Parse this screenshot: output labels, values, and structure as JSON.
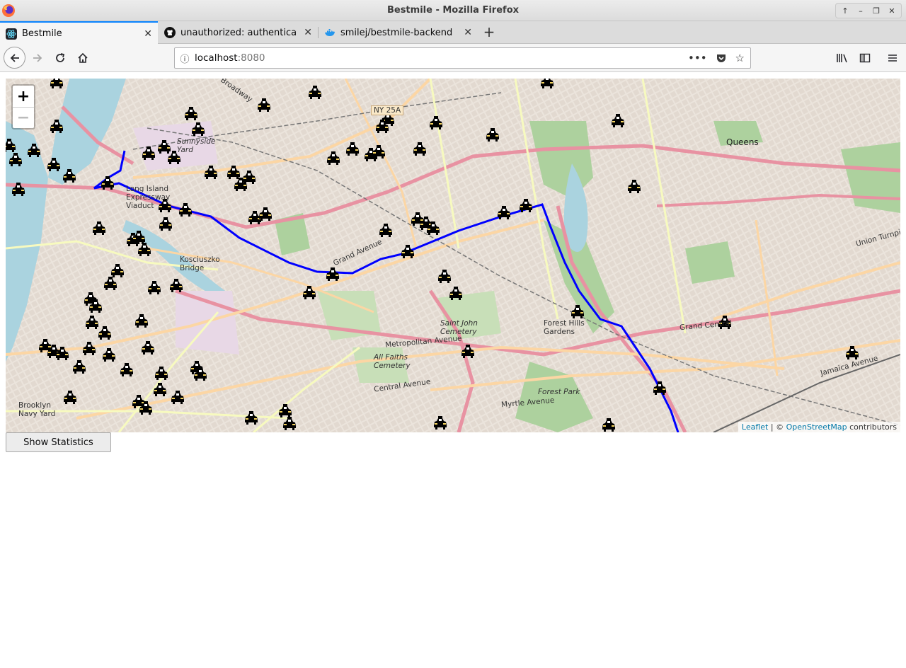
{
  "window": {
    "title": "Bestmile - Mozilla Firefox"
  },
  "tabs": [
    {
      "label": "Bestmile",
      "active": true,
      "icon": "react-icon"
    },
    {
      "label": "unauthorized: authentica",
      "active": false,
      "icon": "github-icon"
    },
    {
      "label": "smilej/bestmile-backend",
      "active": false,
      "icon": "docker-icon"
    }
  ],
  "navbar": {
    "url_host": "localhost",
    "url_port": ":8080"
  },
  "map": {
    "zoom_in": "+",
    "zoom_out": "−",
    "attribution_leaflet": "Leaflet",
    "attribution_sep": " | © ",
    "attribution_osm": "OpenStreetMap",
    "attribution_suffix": " contributors",
    "labels": {
      "queens": "Queens",
      "sunnyside_yard": "Sunnyside Yard",
      "long_island_expressway": "Long Island Expressway Viaduct",
      "kosciuszko_bridge": "Kosciuszko Bridge",
      "saint_john_cemetery": "Saint John Cemetery",
      "all_faiths_cemetery": "All Faiths Cemetery",
      "forest_hills_gardens": "Forest Hills Gardens",
      "forest_park": "Forest Park",
      "brooklyn_navy_yard": "Brooklyn Navy Yard",
      "grand_avenue": "Grand Avenue",
      "metropolitan_avenue": "Metropolitan Avenue",
      "myrtle_avenue": "Myrtle Avenue",
      "union_turnpike": "Union Turnpike",
      "jamaica_avenue": "Jamaica Avenue",
      "grand_central": "Grand Central",
      "broadway": "Broadway",
      "central_avenue": "Central Avenue",
      "ny25a": "NY 25A"
    }
  },
  "page": {
    "stats_button": "Show Statistics"
  },
  "colors": {
    "route": "#0000ff",
    "tab_accent": "#0a84ff",
    "water": "#aad3df",
    "park": "#add19e",
    "motorway": "#e892a2",
    "trunk": "#f9b29c",
    "primary": "#fcd6a4",
    "secondary": "#f7fabf"
  }
}
